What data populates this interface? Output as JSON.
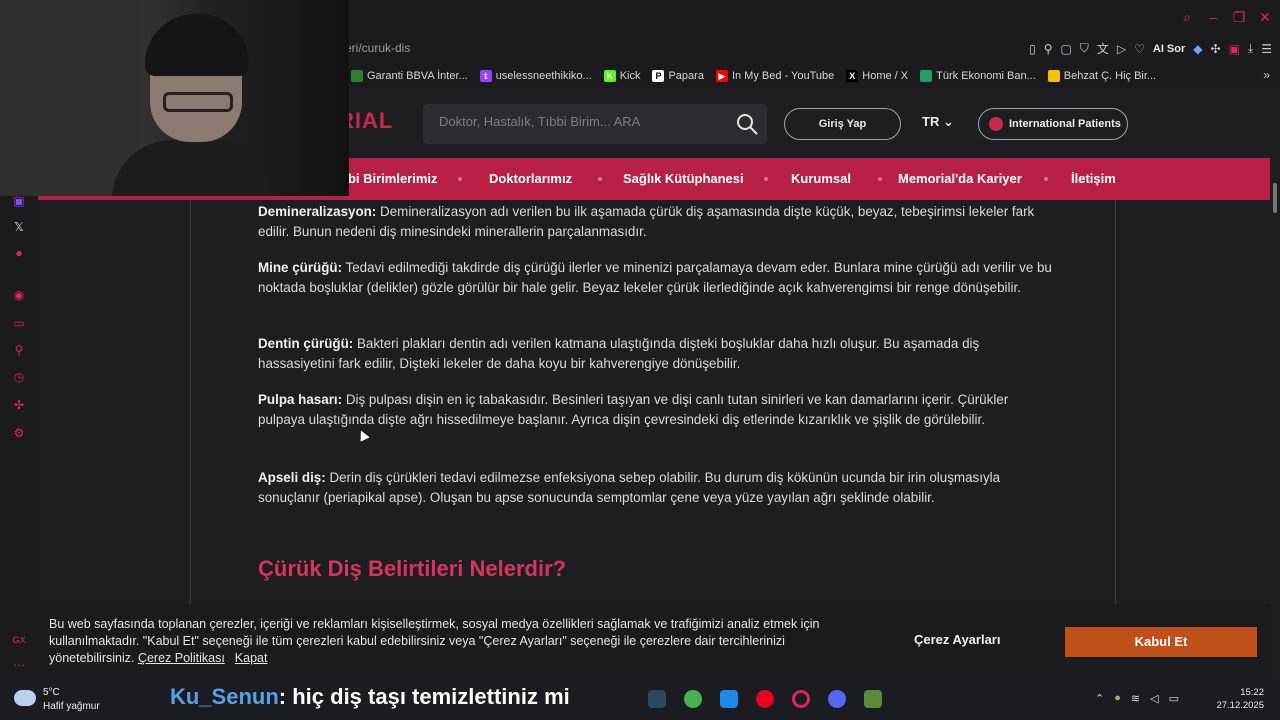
{
  "browser": {
    "url": "eri/curuk-dis",
    "ai_label": "AI Sor",
    "bookmarks": [
      {
        "label": "Garanti BBVA İnter...",
        "color": "#2e7d32",
        "glyph": ""
      },
      {
        "label": "uselessneethikiko...",
        "color": "#9146ff",
        "glyph": "t"
      },
      {
        "label": "Kick",
        "color": "#53fc18",
        "glyph": "K"
      },
      {
        "label": "Papara",
        "color": "#ffffff",
        "glyph": "P"
      },
      {
        "label": "In My Bed - YouTube",
        "color": "#ff0000",
        "glyph": "▶"
      },
      {
        "label": "Home / X",
        "color": "#000000",
        "glyph": "X"
      },
      {
        "label": "Türk Ekonomi Ban...",
        "color": "#1fa060",
        "glyph": ""
      },
      {
        "label": "Behzat Ç. Hiç Bir...",
        "color": "#f2c200",
        "glyph": ""
      }
    ]
  },
  "site": {
    "logo": "RIAL",
    "search_placeholder": "Doktor, Hastalık, Tıbbi Birim... ARA",
    "login": "Giriş Yap",
    "lang": "TR",
    "international": "International Patients",
    "nav": [
      "bbi Birimlerimiz",
      "Doktorlarımız",
      "Sağlık Kütüphanesi",
      "Kurumsal",
      "Memorial'da Kariyer",
      "İletişim"
    ]
  },
  "article": {
    "paragraphs": [
      {
        "term": "Demineralizasyon:",
        "text": " Demineralizasyon adı verilen bu ilk aşamada çürük diş aşamasında dişte küçük, beyaz, tebeşirimsi lekeler fark edilir. Bunun nedeni diş minesindeki minerallerin parçalanmasıdır."
      },
      {
        "term": "Mine çürüğü:",
        "text": " Tedavi edilmediği takdirde diş çürüğü ilerler ve minenizi parçalamaya devam eder. Bunlara mine çürüğü adı verilir ve bu noktada boşluklar (delikler) gözle görülür bir hale gelir. Beyaz lekeler çürük ilerlediğinde açık kahverengimsi bir renge dönüşebilir."
      },
      {
        "term": "Dentin çürüğü:",
        "text": " Bakteri plakları dentin adı verilen katmana ulaştığında dişteki boşluklar daha hızlı oluşur. Bu aşamada diş hassasiyetini fark edilir, Dişteki lekeler de daha koyu bir kahverengiye dönüşebilir."
      },
      {
        "term": "Pulpa hasarı:",
        "text": " Diş pulpası dişin en iç tabakasıdır. Besinleri taşıyan ve dişi canlı tutan sinirleri ve kan damarlarını içerir. Çürükler pulpaya ulaştığında dişte ağrı hissedilmeye başlanır. Ayrıca dişin çevresindeki diş etlerinde kızarıklık ve şişlik de görülebilir."
      },
      {
        "term": "Apseli diş:",
        "text": " Derin diş çürükleri tedavi edilmezse enfeksiyona sebep olabilir. Bu durum diş kökünün ucunda bir irin oluşmasıyla sonuçlanır (periapikal apse). Oluşan bu apse sonucunda semptomlar çene veya yüze yayılan ağrı şeklinde olabilir."
      }
    ],
    "heading": "Çürük Diş Belirtileri Nelerdir?"
  },
  "cookie": {
    "text": "Bu web sayfasında toplanan çerezler, içeriği ve reklamları kişiselleştirmek, sosyal medya özellikleri sağlamak ve trafiğimizi analiz etmek için kullanılmaktadır. \"Kabul Et\" seçeneği ile tüm çerezleri kabul edebilirsiniz veya \"Çerez Ayarları\" seçeneği ile çerezlere dair tercihlerinizi yönetebilirsiniz.",
    "policy_link": "Çerez Politikası",
    "close_link": "Kapat",
    "settings_button": "Çerez Ayarları",
    "accept_button": "Kabul Et"
  },
  "taskbar": {
    "temp": "5°C",
    "weather": "Hafif yağmur",
    "chat_user": "Ku_Senun",
    "chat_message": ": hiç diş taşı temizlettiniz mi",
    "time": "15:22",
    "date": "27.12.2025"
  }
}
